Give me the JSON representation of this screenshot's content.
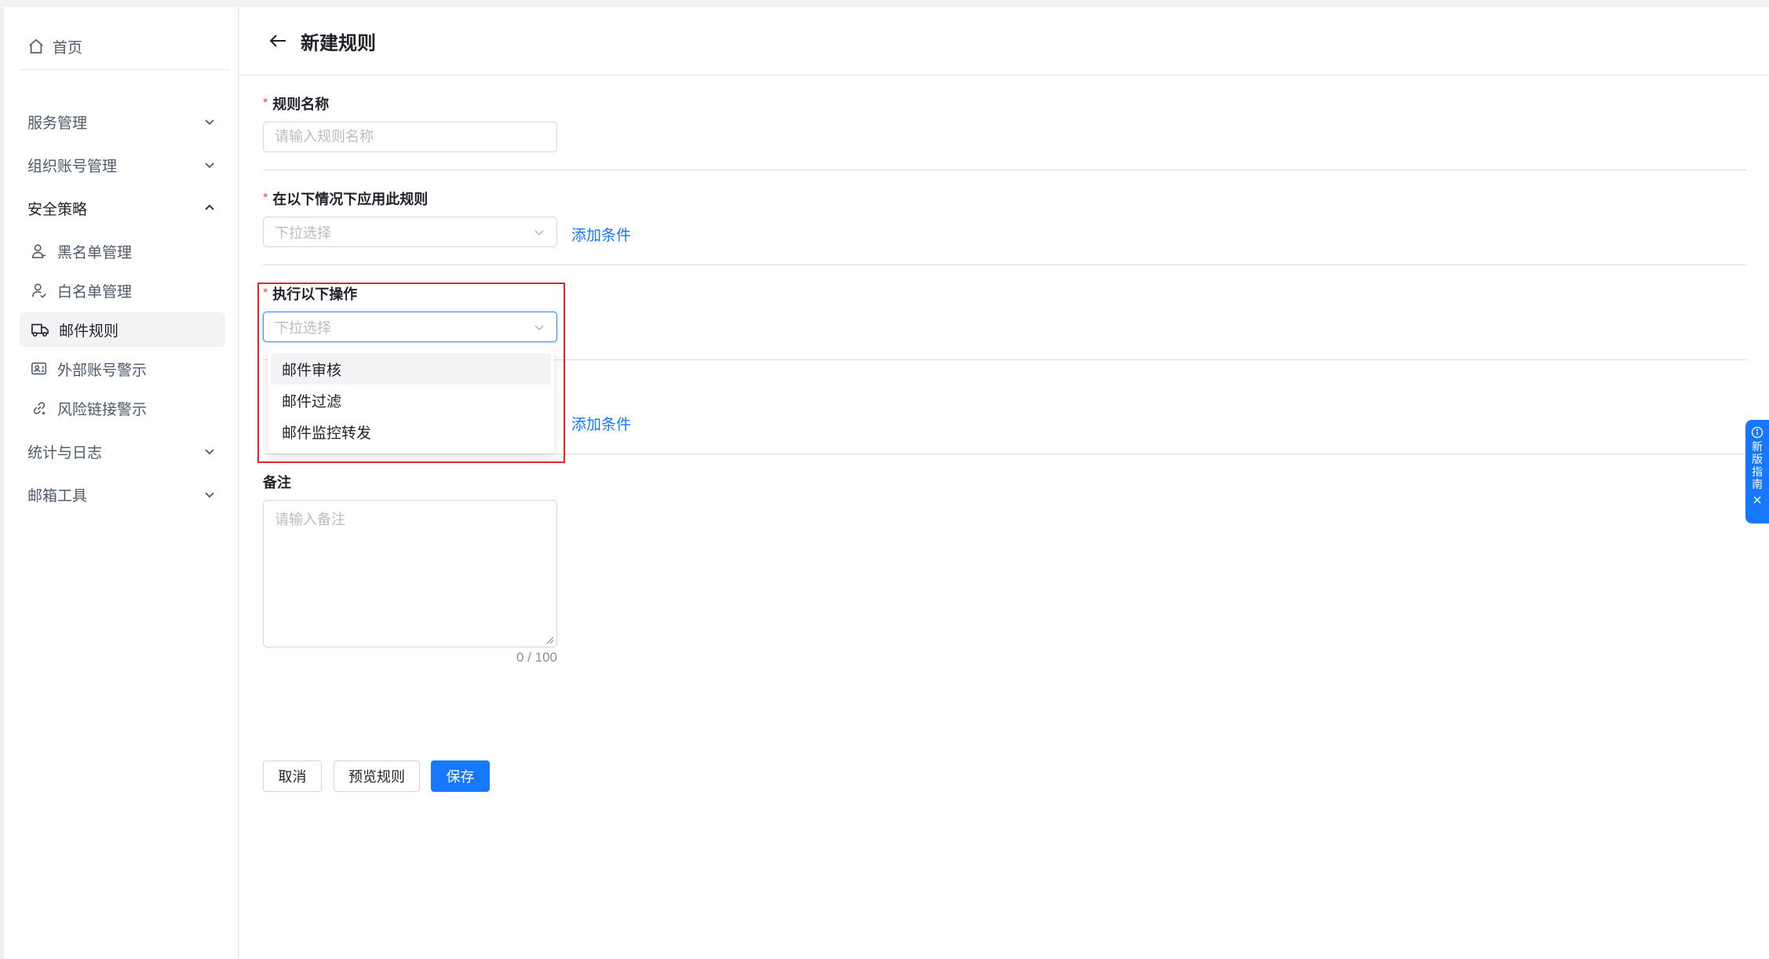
{
  "sidebar": {
    "home_label": "首页",
    "groups": [
      {
        "label": "服务管理"
      },
      {
        "label": "组织账号管理"
      },
      {
        "label": "安全策略"
      },
      {
        "label": "统计与日志"
      },
      {
        "label": "邮箱工具"
      }
    ],
    "security_items": [
      {
        "label": "黑名单管理",
        "icon": "user-icon"
      },
      {
        "label": "白名单管理",
        "icon": "user-check-icon"
      },
      {
        "label": "邮件规则",
        "icon": "truck-icon",
        "active": true
      },
      {
        "label": "外部账号警示",
        "icon": "id-alert-icon"
      },
      {
        "label": "风险链接警示",
        "icon": "link-icon"
      }
    ]
  },
  "header": {
    "title": "新建规则"
  },
  "form": {
    "rule_name": {
      "label": "规则名称",
      "placeholder": "请输入规则名称"
    },
    "condition": {
      "label": "在以下情况下应用此规则",
      "placeholder": "下拉选择",
      "add_link": "添加条件"
    },
    "action": {
      "label": "执行以下操作",
      "placeholder": "下拉选择",
      "options": [
        "邮件审核",
        "邮件过滤",
        "邮件监控转发"
      ]
    },
    "hidden_section": {
      "add_link": "添加条件"
    },
    "remark": {
      "label": "备注",
      "placeholder": "请输入备注",
      "counter": "0 / 100"
    }
  },
  "buttons": {
    "cancel": "取消",
    "preview": "预览规则",
    "save": "保存"
  },
  "guide": {
    "text": "新版指南"
  },
  "colors": {
    "primary": "#1677ff",
    "required": "#f53f3f",
    "highlight": "#e0282e"
  }
}
